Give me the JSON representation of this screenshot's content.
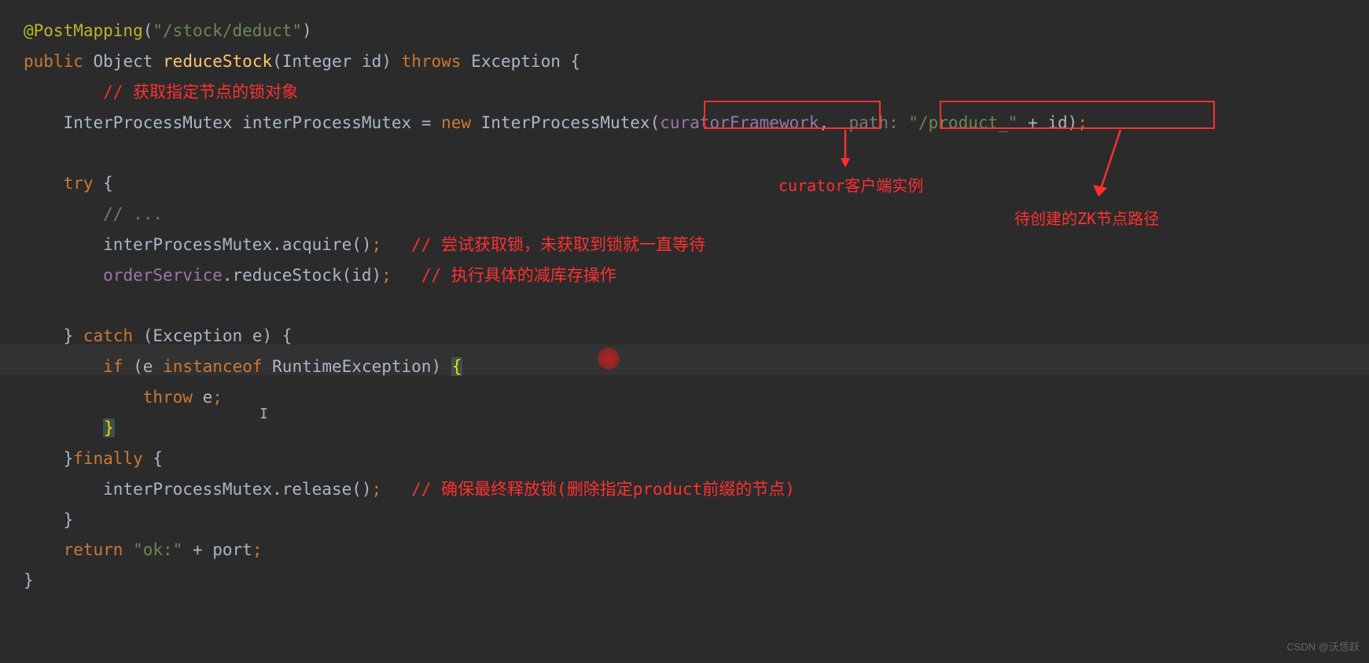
{
  "code": {
    "annotation": "@PostMapping",
    "mapping_path": "\"/stock/deduct\"",
    "public": "public",
    "return_type": "Object",
    "method_name": "reduceStock",
    "param_type": "Integer",
    "param_name": "id",
    "throws": "throws",
    "exception": "Exception",
    "comment1": "// 获取指定节点的锁对象",
    "mutex_type": "InterProcessMutex",
    "mutex_var": "interProcessMutex",
    "new": "new",
    "ctor": "InterProcessMutex",
    "arg1": "curatorFramework",
    "path_hint": "path:",
    "path_str": "\"/product_\"",
    "plus_id": "+ id",
    "try": "try",
    "comment_dots": "// ...",
    "acquire_call": "interProcessMutex.acquire()",
    "comment2": "// 尝试获取锁，未获取到锁就一直等待",
    "order_service": "orderService",
    "reduce_stock": ".reduceStock(id)",
    "comment3": "// 执行具体的减库存操作",
    "catch": "catch",
    "exc_param": "(Exception e)",
    "if": "if",
    "instanceof": "instanceof",
    "runtime_exc": "RuntimeException",
    "throw": "throw",
    "e_var": "e",
    "finally": "finally",
    "release_call": "interProcessMutex.release()",
    "comment4": "// 确保最终释放锁(删除指定product前缀的节点)",
    "return": "return",
    "ok_str": "\"ok:\"",
    "plus_port": "+ port"
  },
  "annotations": {
    "label1": "curator客户端实例",
    "label2": "待创建的ZK节点路径"
  },
  "watermark": "CSDN @沃恁跃"
}
